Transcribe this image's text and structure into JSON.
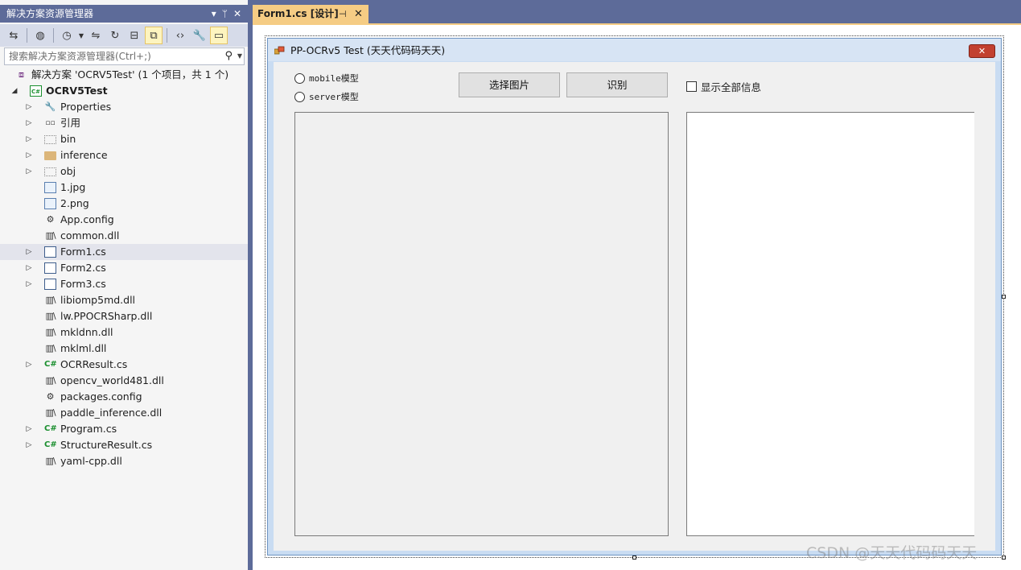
{
  "solution_explorer": {
    "title": "解决方案资源管理器",
    "title_buttons": [
      "▾",
      "ᛘ",
      "✕"
    ],
    "search_placeholder": "搜索解决方案资源管理器(Ctrl+;)",
    "solution_label": "解决方案 'OCRV5Test' (1 个项目，共 1 个)",
    "project_label": "OCRV5Test",
    "items": [
      {
        "label": "Properties",
        "icon": "wrench-icon",
        "expandable": true
      },
      {
        "label": "引用",
        "icon": "references-icon",
        "expandable": true
      },
      {
        "label": "bin",
        "icon": "hidden-folder-icon",
        "expandable": true
      },
      {
        "label": "inference",
        "icon": "folder-icon",
        "expandable": true
      },
      {
        "label": "obj",
        "icon": "hidden-folder-icon",
        "expandable": true
      },
      {
        "label": "1.jpg",
        "icon": "image-file-icon",
        "expandable": false
      },
      {
        "label": "2.png",
        "icon": "image-file-icon",
        "expandable": false
      },
      {
        "label": "App.config",
        "icon": "config-file-icon",
        "expandable": false
      },
      {
        "label": "common.dll",
        "icon": "dll-file-icon",
        "expandable": false
      },
      {
        "label": "Form1.cs",
        "icon": "form-file-icon",
        "expandable": true,
        "selected": true
      },
      {
        "label": "Form2.cs",
        "icon": "form-file-icon",
        "expandable": true
      },
      {
        "label": "Form3.cs",
        "icon": "form-file-icon",
        "expandable": true
      },
      {
        "label": "libiomp5md.dll",
        "icon": "dll-file-icon",
        "expandable": false
      },
      {
        "label": "lw.PPOCRSharp.dll",
        "icon": "dll-file-icon",
        "expandable": false
      },
      {
        "label": "mkldnn.dll",
        "icon": "dll-file-icon",
        "expandable": false
      },
      {
        "label": "mklml.dll",
        "icon": "dll-file-icon",
        "expandable": false
      },
      {
        "label": "OCRResult.cs",
        "icon": "csharp-file-icon",
        "expandable": true
      },
      {
        "label": "opencv_world481.dll",
        "icon": "dll-file-icon",
        "expandable": false
      },
      {
        "label": "packages.config",
        "icon": "config-file-icon",
        "expandable": false
      },
      {
        "label": "paddle_inference.dll",
        "icon": "dll-file-icon",
        "expandable": false
      },
      {
        "label": "Program.cs",
        "icon": "csharp-file-icon",
        "expandable": true
      },
      {
        "label": "StructureResult.cs",
        "icon": "csharp-file-icon",
        "expandable": true
      },
      {
        "label": "yaml-cpp.dll",
        "icon": "dll-file-icon",
        "expandable": false
      }
    ]
  },
  "document_tab": {
    "label": "Form1.cs [设计]",
    "pin": "⊣",
    "close": "✕"
  },
  "form": {
    "title": "PP-OCRv5 Test  (天天代码码天天)",
    "close": "✕",
    "radio_mobile": "mobile模型",
    "radio_server": "server模型",
    "select_image_button": "选择图片",
    "recognize_button": "识别",
    "show_all_checkbox": "显示全部信息"
  },
  "watermark": "CSDN @天天代码码天天",
  "colors": {
    "title_bar": "#5d6b99",
    "active_tab": "#f5cc84",
    "selected_row": "#e3e4ec",
    "csharp_green": "#1b8f2f"
  }
}
